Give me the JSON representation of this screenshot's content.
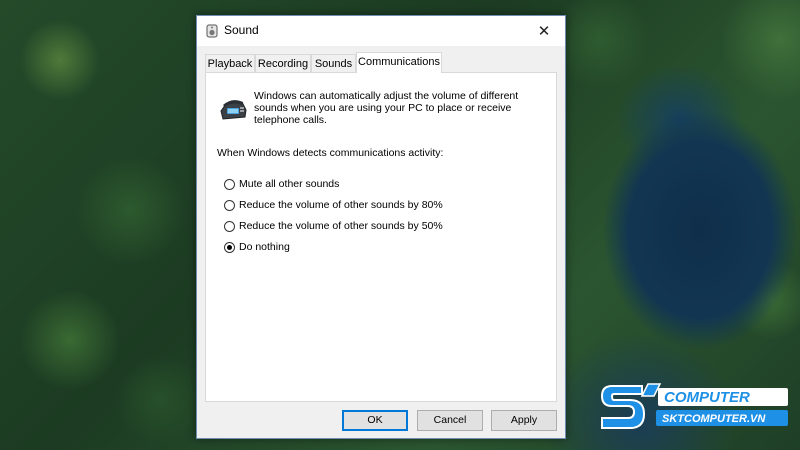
{
  "window": {
    "title": "Sound",
    "close_glyph": "✕"
  },
  "tabs": [
    {
      "label": "Playback",
      "active": false
    },
    {
      "label": "Recording",
      "active": false
    },
    {
      "label": "Sounds",
      "active": false
    },
    {
      "label": "Communications",
      "active": true
    }
  ],
  "communications": {
    "intro_icon": "telephone-icon",
    "intro_text": "Windows can automatically adjust the volume of different sounds when you are using your PC to place or receive telephone calls.",
    "detect_label": "When Windows detects communications activity:",
    "options": [
      {
        "label": "Mute all other sounds",
        "checked": false
      },
      {
        "label": "Reduce the volume of other sounds by 80%",
        "checked": false
      },
      {
        "label": "Reduce the volume of other sounds by 50%",
        "checked": false
      },
      {
        "label": "Do nothing",
        "checked": true
      }
    ]
  },
  "buttons": {
    "ok": "OK",
    "cancel": "Cancel",
    "apply": "Apply"
  },
  "watermark": {
    "brand": "COMPUTER",
    "site": "SKTCOMPUTER.VN"
  },
  "colors": {
    "accent": "#0078d7",
    "logo_blue": "#1e90e6"
  }
}
